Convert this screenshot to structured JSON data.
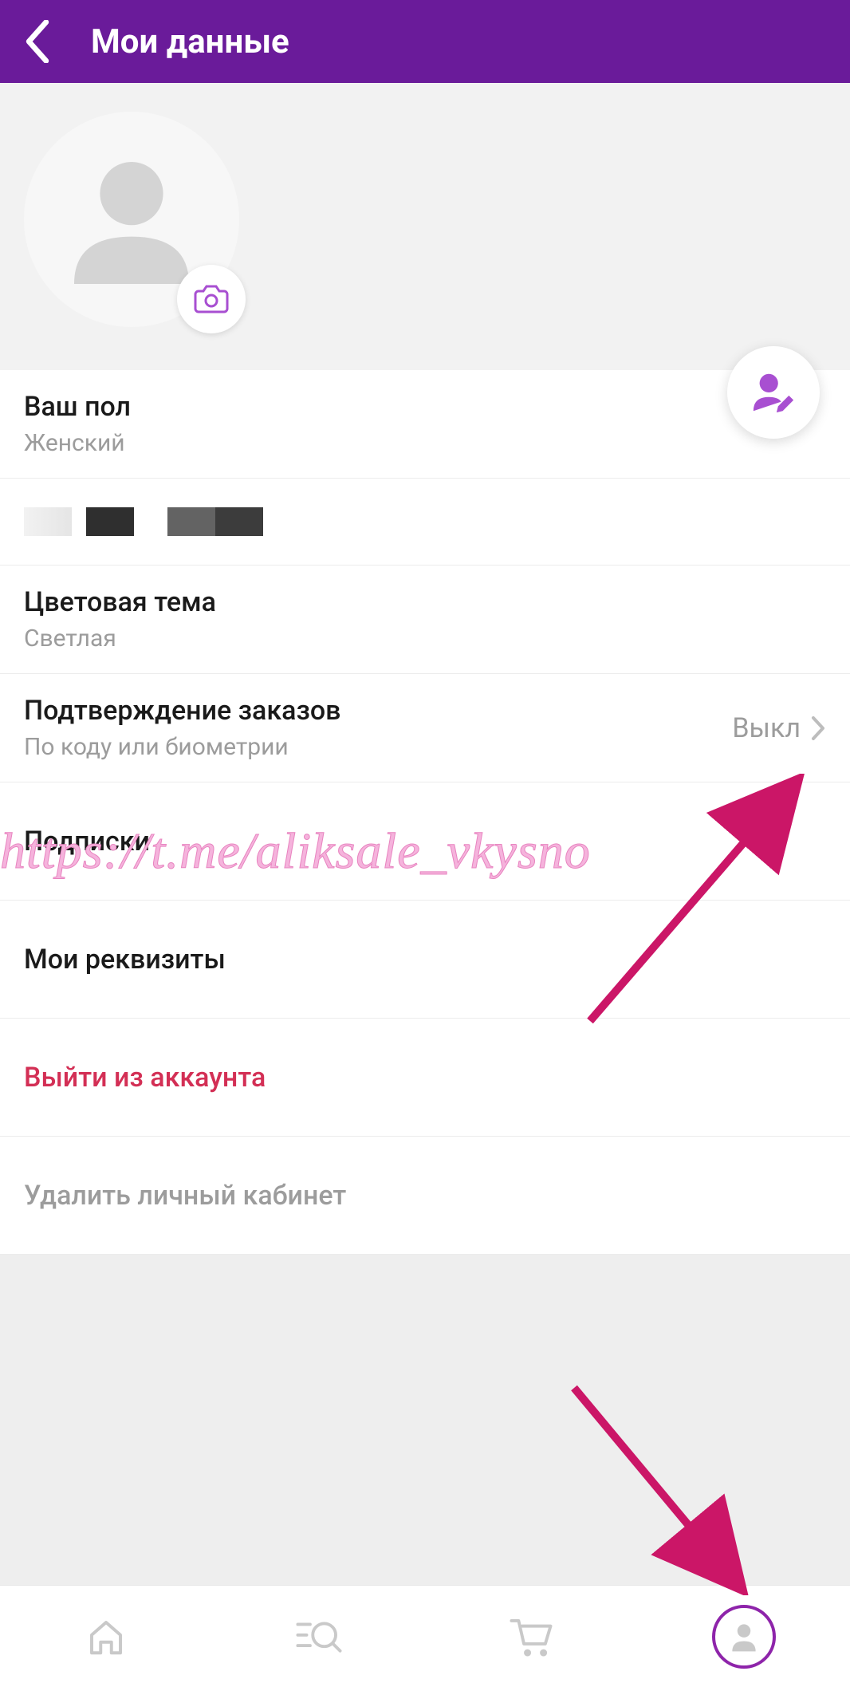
{
  "header": {
    "title": "Мои данные"
  },
  "colors": {
    "accent": "#8e24aa",
    "headerBg": "#6a1b9a",
    "danger": "#d32f55",
    "annotation": "#cb1667"
  },
  "gender": {
    "label": "Ваш пол",
    "value": "Женский"
  },
  "theme": {
    "label": "Цветовая тема",
    "value": "Светлая"
  },
  "confirm": {
    "label": "Подтверждение заказов",
    "sub": "По коду или биометрии",
    "state": "Выкл"
  },
  "subscriptions": {
    "label": "Подписки"
  },
  "requisites": {
    "label": "Мои реквизиты"
  },
  "logout": {
    "label": "Выйти из аккаунта"
  },
  "delete": {
    "label": "Удалить личный кабинет"
  },
  "watermark": "https://t.me/aliksale_vkysno"
}
